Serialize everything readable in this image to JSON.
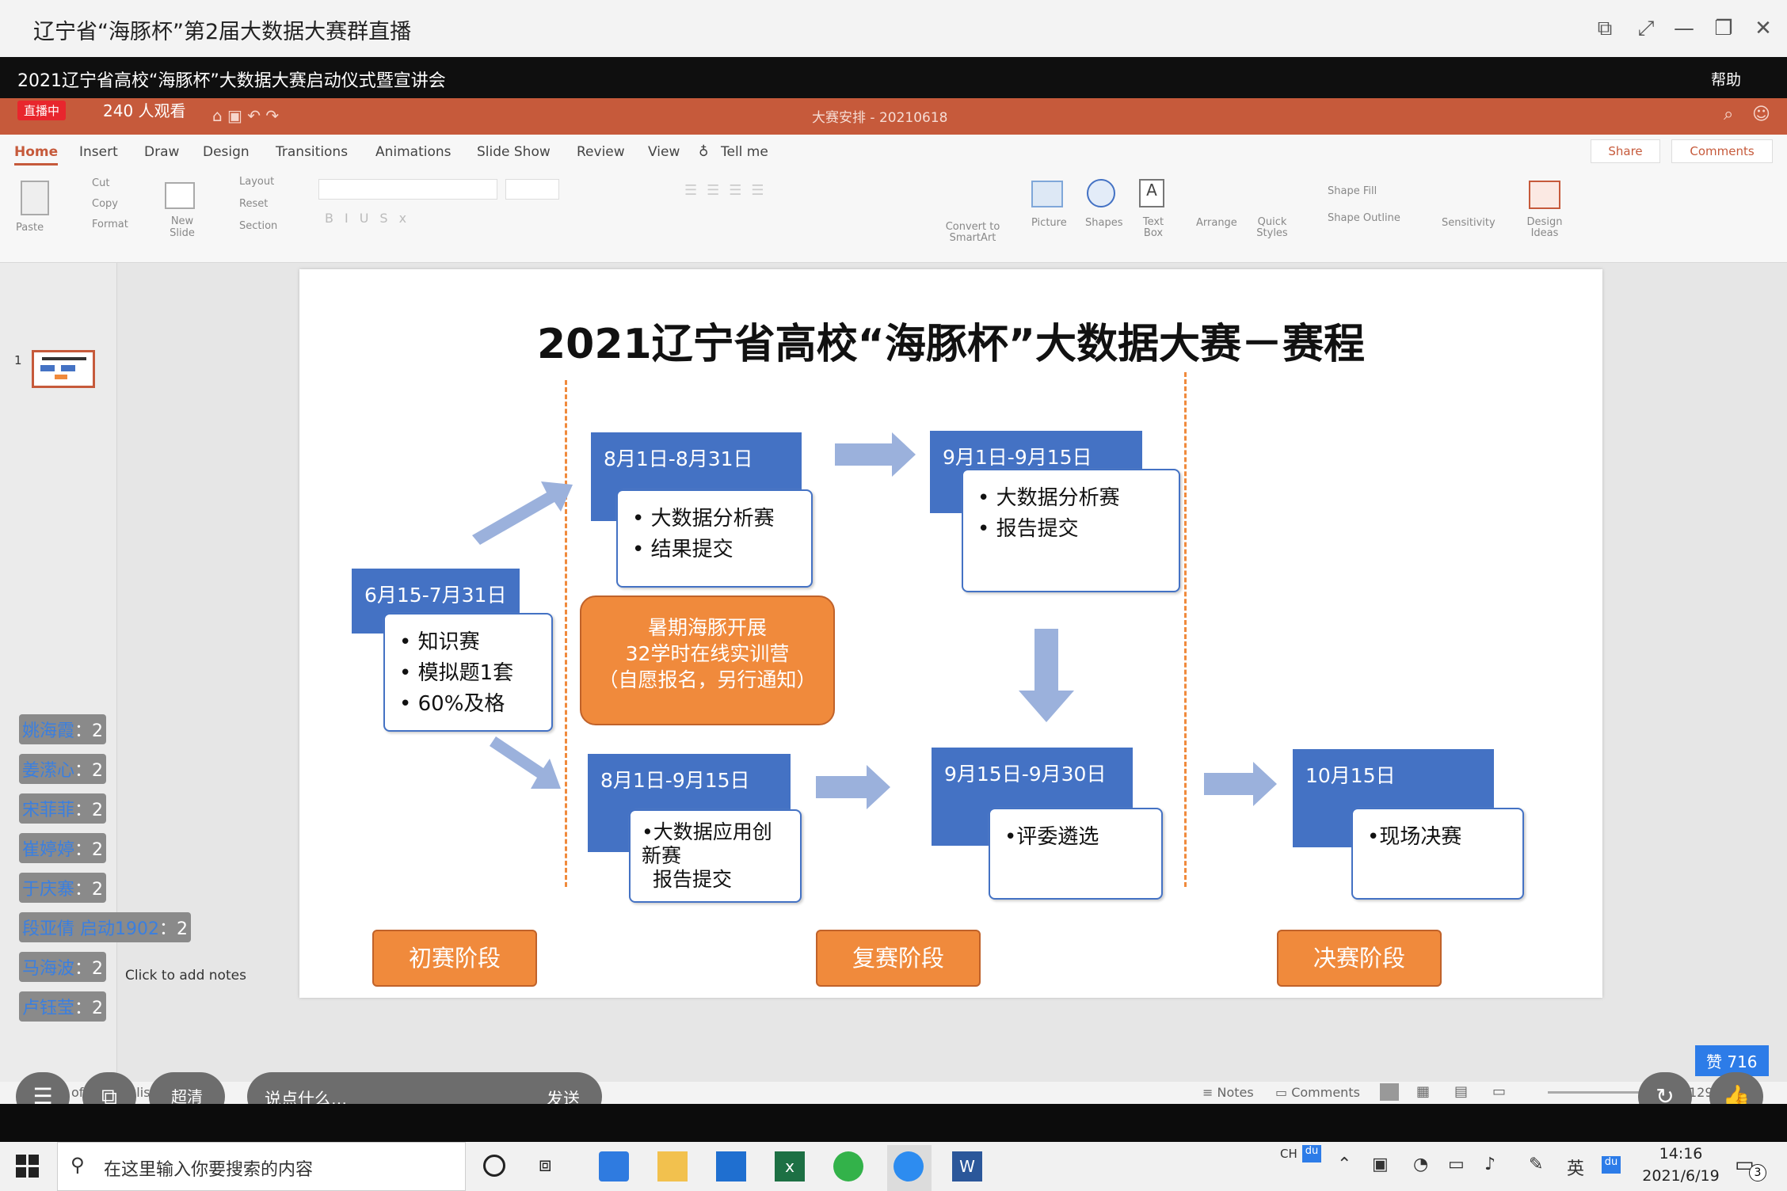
{
  "window": {
    "title": "辽宁省“海豚杯”第2届大数据大赛群直播"
  },
  "live": {
    "title": "2021辽宁省高校“海豚杯”大数据大赛启动仪式暨宣讲会",
    "help": "帮助",
    "badge": "直播中",
    "viewers": "240 人观看"
  },
  "ppt": {
    "doc_title": "大赛安排 - 20210618",
    "share": "Share",
    "comments": "Comments",
    "tabs": [
      "Home",
      "Insert",
      "Draw",
      "Design",
      "Transitions",
      "Animations",
      "Slide Show",
      "Review",
      "View",
      "Tell me"
    ],
    "ribbon": {
      "paste": "Paste",
      "cut": "Cut",
      "copy": "Copy",
      "format": "Format",
      "new_slide": "New Slide",
      "layout": "Layout",
      "reset": "Reset",
      "section": "Section",
      "convert": "Convert to SmartArt",
      "picture": "Picture",
      "shapes": "Shapes",
      "textbox": "Text Box",
      "arrange": "Arrange",
      "quick_styles": "Quick Styles",
      "shape_fill": "Shape Fill",
      "shape_outline": "Shape Outline",
      "sensitivity": "Sensitivity",
      "design_ideas": "Design Ideas"
    },
    "thumb_num": "1",
    "notes_placeholder": "Click to add notes",
    "status": {
      "slide": "of 1",
      "lang": "nglish",
      "notes": "Notes",
      "comments": "Comments",
      "zoom": "129%"
    }
  },
  "slide": {
    "title": "2021辽宁省高校“海豚杯”大数据大赛－赛程",
    "box1": {
      "date": "6月15-7月31日",
      "items": [
        "知识赛",
        "模拟题1套",
        "60%及格"
      ]
    },
    "box2": {
      "date": "8月1日-8月31日",
      "items": [
        "大数据分析赛",
        "结果提交"
      ]
    },
    "box3": {
      "date": "9月1日-9月15日",
      "items": [
        "大数据分析赛",
        "报告提交"
      ]
    },
    "box4": {
      "date": "8月1日-9月15日",
      "items": [
        "大数据应用创新赛",
        "报告提交"
      ]
    },
    "box5": {
      "date": "9月15日-9月30日",
      "items": [
        "评委遴选"
      ]
    },
    "box6": {
      "date": "10月15日",
      "items": [
        "现场决赛"
      ]
    },
    "camp": [
      "暑期海豚开展",
      "32学时在线实训营",
      "（自愿报名，另行通知）"
    ],
    "stage1": "初赛阶段",
    "stage2": "复赛阶段",
    "stage3": "决赛阶段"
  },
  "chat": [
    {
      "name": "姚海霞",
      "count": "：2"
    },
    {
      "name": "姜潆心",
      "count": "：2"
    },
    {
      "name": "宋菲菲",
      "count": "：2"
    },
    {
      "name": "崔婷婷",
      "count": "：2"
    },
    {
      "name": "于庆寨",
      "count": "：2"
    },
    {
      "name": "段亚倩 启动1902",
      "count": "：2"
    },
    {
      "name": "马海波",
      "count": "：2"
    },
    {
      "name": "卢钰莹",
      "count": "：2"
    }
  ],
  "controls": {
    "quality": "超清",
    "input_placeholder": "说点什么...",
    "send": "发送",
    "likes": "赞 716"
  },
  "taskbar": {
    "search_placeholder": "在这里输入你要搜索的内容",
    "time": "14:16",
    "date": "2021/6/19",
    "lang": "英",
    "ch": "CH",
    "notif": "3"
  }
}
